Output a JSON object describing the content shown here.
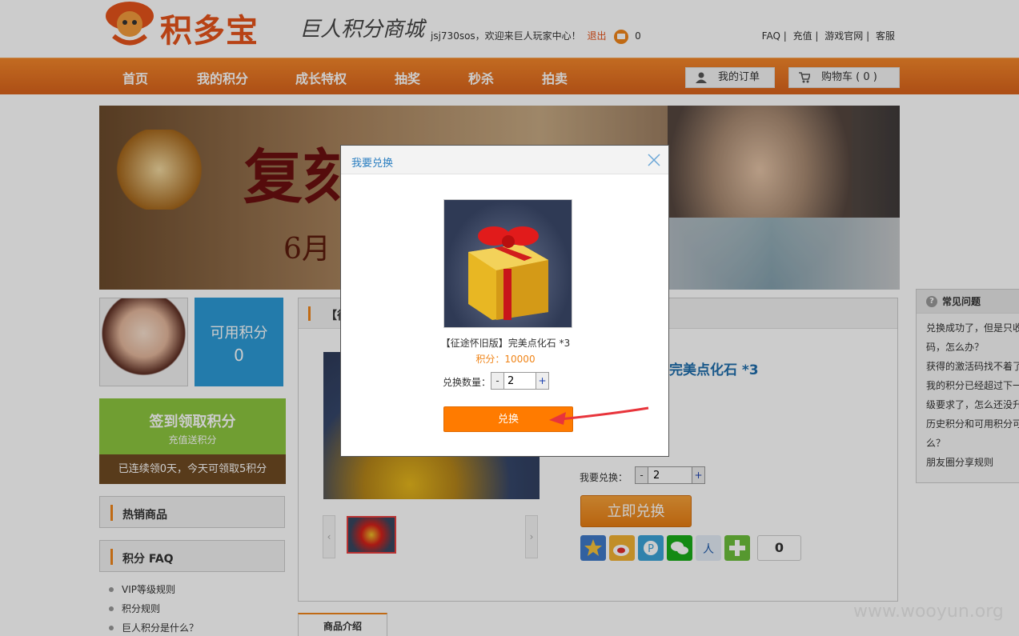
{
  "header": {
    "logo_text": "积多宝",
    "slogan": "巨人积分商城",
    "welcome": "jsj730sos，欢迎来巨人玩家中心！",
    "logout": "退出",
    "message_count": "0",
    "links": [
      "FAQ |",
      "充值 |",
      "游戏官网 |",
      "客服"
    ]
  },
  "nav": {
    "items": [
      "首页",
      "我的积分",
      "成长特权",
      "抽奖",
      "秒杀",
      "拍卖"
    ],
    "my_orders": "我的订单",
    "cart": "购物车 ( 0 )"
  },
  "banner": {
    "title": "复刻",
    "date": "6月"
  },
  "sidebar": {
    "points_label": "可用积分",
    "points_value": "0",
    "checkin_title": "签到领取积分",
    "checkin_sub": "充值送积分",
    "checkin_status": "已连续领0天，今天可领取5积分",
    "hot_title": "热销商品",
    "faq_title": "积分 FAQ",
    "faq_items": [
      "VIP等级规则",
      "积分规则",
      "巨人积分是什么？"
    ]
  },
  "product": {
    "head_title": "【征",
    "name_partial": "完美点化石 *3",
    "want_label": "我要兑换：",
    "qty": "2",
    "buy_button": "立即兑换",
    "share_count": "0",
    "desc_tab": "商品介绍"
  },
  "right_faq": {
    "title": "常见问题",
    "items": [
      "兑换成功了，但是只收",
      "码，怎么办？",
      "获得的激活码找不着了",
      "我的积分已经超过下一",
      "级要求了，怎么还没升",
      "历史积分和可用积分可",
      "么？",
      "朋友圈分享规则"
    ]
  },
  "modal": {
    "title": "我要兑换",
    "item_name": "【征途怀旧版】完美点化石 *3",
    "price": "积分：10000",
    "qty_label": "兑换数量：",
    "qty": "2",
    "confirm": "兑换"
  },
  "colors": {
    "brand_orange": "#f08519",
    "nav_orange": "#e36f1f",
    "points_blue": "#2c9ad6",
    "checkin_green": "#8cc63f",
    "confirm_orange": "#ff7b00"
  },
  "watermark": "www.wooyun.org"
}
